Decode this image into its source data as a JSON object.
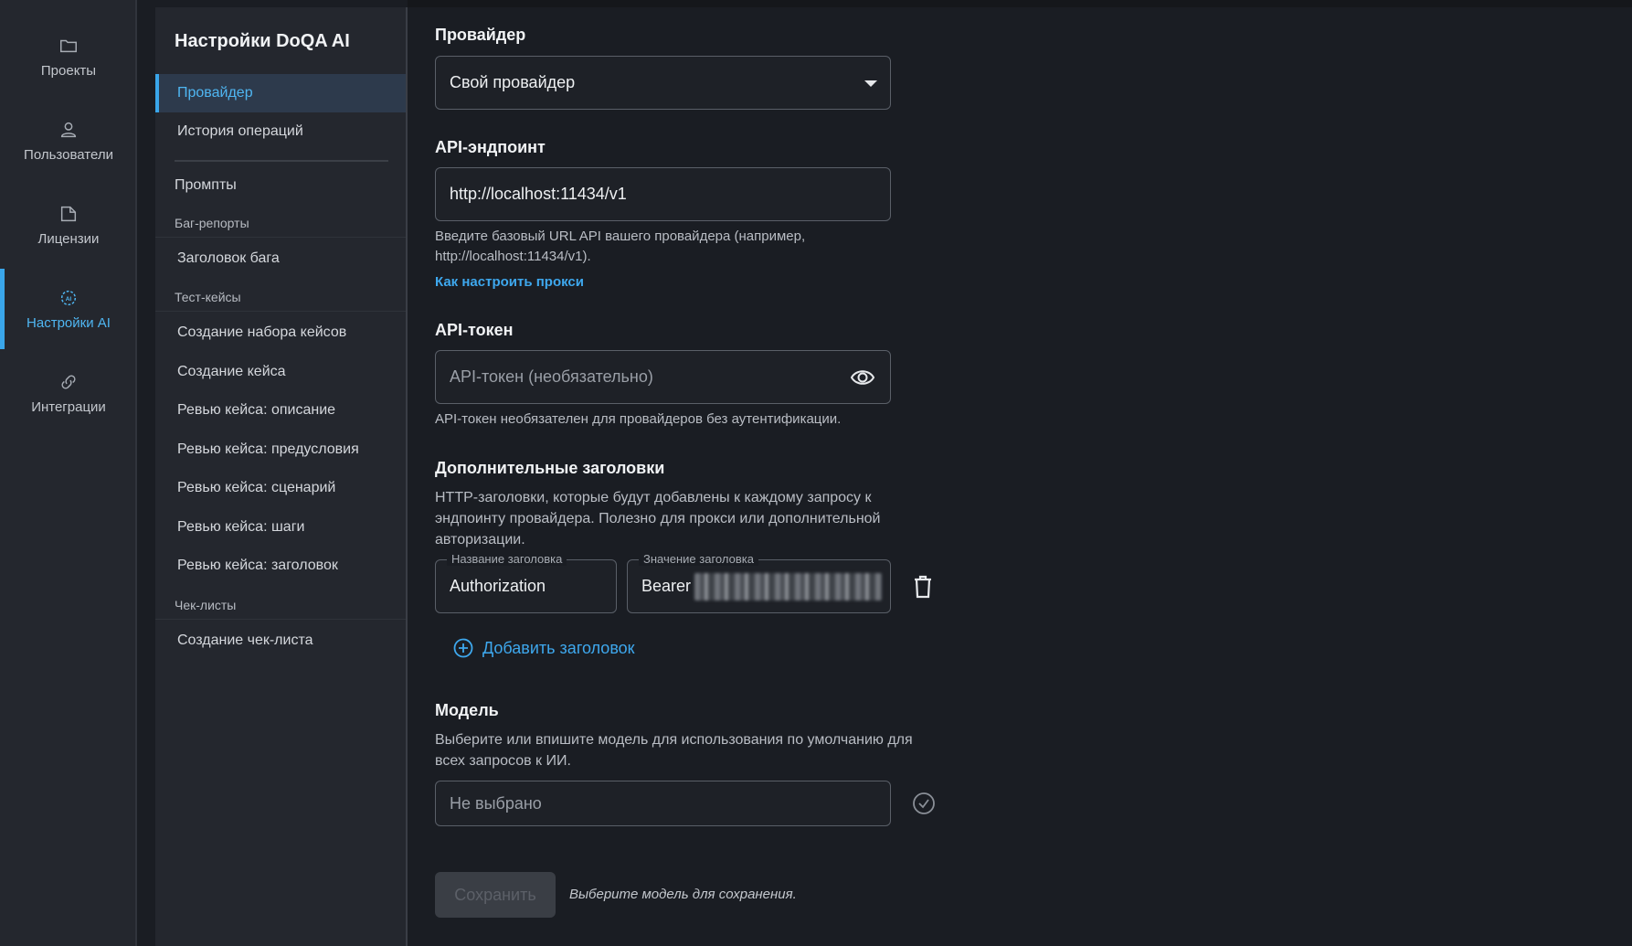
{
  "rail": {
    "items": [
      {
        "label": "Проекты",
        "icon": "folder-icon"
      },
      {
        "label": "Пользователи",
        "icon": "user-icon"
      },
      {
        "label": "Лицензии",
        "icon": "license-icon"
      },
      {
        "label": "Настройки AI",
        "icon": "ai-icon",
        "active": true
      },
      {
        "label": "Интеграции",
        "icon": "link-icon"
      }
    ]
  },
  "settings": {
    "title": "Настройки DoQA AI",
    "items": {
      "provider": "Провайдер",
      "history": "История операций",
      "prompts": "Промпты",
      "bug_title": "Заголовок бага",
      "case_set": "Создание набора кейсов",
      "case_create": "Создание кейса",
      "review_desc": "Ревью кейса: описание",
      "review_pre": "Ревью кейса: предусловия",
      "review_scen": "Ревью кейса: сценарий",
      "review_steps": "Ревью кейса: шаги",
      "review_title": "Ревью кейса: заголовок",
      "checklist_create": "Создание чек-листа"
    },
    "groups": {
      "bugs": "Баг-репорты",
      "testcases": "Тест-кейсы",
      "checklists": "Чек-листы"
    }
  },
  "form": {
    "provider": {
      "label": "Провайдер",
      "value": "Свой провайдер"
    },
    "endpoint": {
      "label": "API-эндпоинт",
      "value": "http://localhost:11434/v1",
      "help_line1": "Введите базовый URL API вашего провайдера (например,",
      "help_line2": "http://localhost:11434/v1).",
      "proxy_link": "Как настроить прокси"
    },
    "token": {
      "label": "API-токен",
      "placeholder": "API-токен (необязательно)",
      "help": "API-токен необязателен для провайдеров без аутентификации."
    },
    "headers": {
      "label": "Дополнительные заголовки",
      "help_line1": "HTTP-заголовки, которые будут добавлены к каждому запросу к",
      "help_line2": "эндпоинту провайдера. Полезно для прокси или дополнительной",
      "help_line3": "авторизации.",
      "name_legend": "Название заголовка",
      "name_value": "Authorization",
      "value_legend": "Значение заголовка",
      "value_prefix": "Bearer",
      "add_label": "Добавить заголовок"
    },
    "model": {
      "label": "Модель",
      "help_line1": "Выберите или впишите модель для использования по умолчанию для",
      "help_line2": "всех запросов к ИИ.",
      "placeholder": "Не выбрано"
    },
    "save_label": "Сохранить",
    "save_hint": "Выберите модель для сохранения."
  }
}
